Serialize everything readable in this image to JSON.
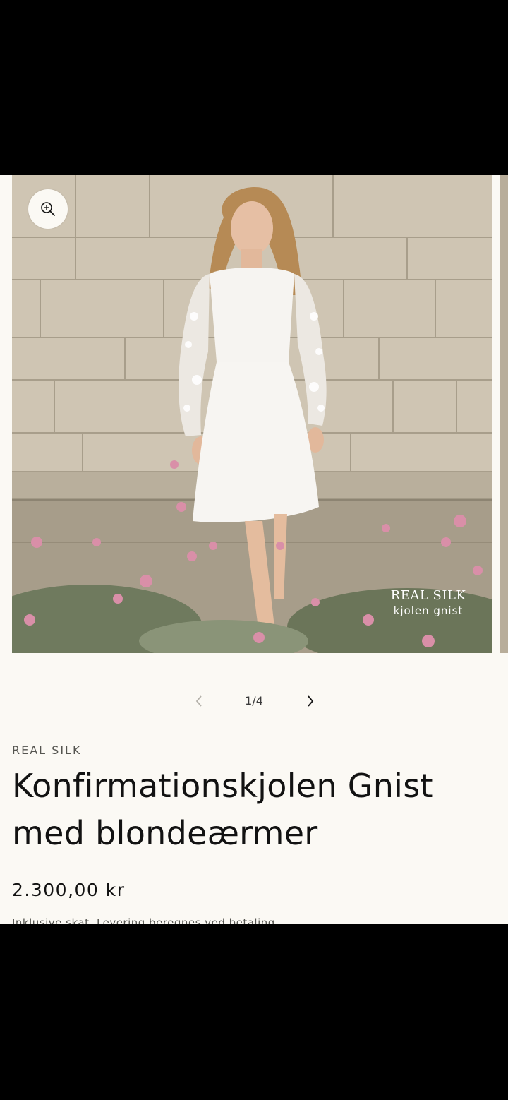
{
  "gallery": {
    "zoom_icon": "zoom-in-icon",
    "watermark_brand": "REAL SILK",
    "watermark_sub": "kjolen gnist",
    "counter": "1/4",
    "prev_icon": "chevron-left-icon",
    "next_icon": "chevron-right-icon"
  },
  "product": {
    "vendor": "REAL SILK",
    "title": "Konfirmationskjolen Gnist med blondeærmer",
    "price": "2.300,00 kr",
    "tax_note": "Inklusive skat. Levering beregnes ved betaling."
  },
  "colors": {
    "page_background": "#fbf9f4",
    "text": "#121212",
    "muted_text": "#555550"
  }
}
